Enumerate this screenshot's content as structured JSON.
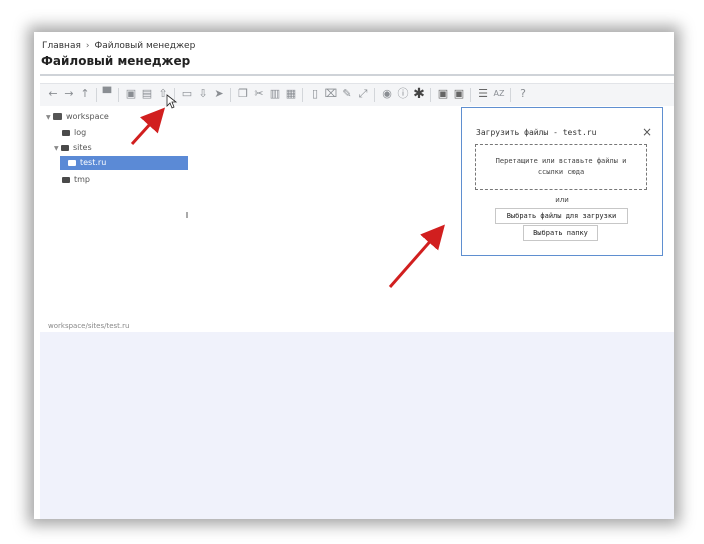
{
  "breadcrumb": {
    "home": "Главная",
    "separator": "›",
    "current": "Файловый менеджер"
  },
  "page_title": "Файловый менеджер",
  "tree": {
    "root": "workspace",
    "items": [
      {
        "label": "log"
      },
      {
        "label": "sites"
      },
      {
        "label": "test.ru"
      },
      {
        "label": "tmp"
      }
    ]
  },
  "status_path": "workspace/sites/test.ru",
  "upload_dialog": {
    "title": "Загрузить файлы - test.ru",
    "close": "×",
    "dropzone_text_line1": "Перетащите или вставьте файлы и",
    "dropzone_text_line2": "ссылки сюда",
    "or": "или",
    "select_files_button": "Выбрать файлы для загрузки",
    "select_folder_button": "Выбрать папку"
  },
  "colors": {
    "accent": "#5b8ad6",
    "dialog_border": "#5f8fd0",
    "annotation_arrow": "#d11f1f"
  },
  "toolbar_icons": [
    "back-icon",
    "forward-icon",
    "up-icon",
    "home-icon",
    "new-folder-icon",
    "new-file-icon",
    "upload-icon",
    "open-icon",
    "download-icon",
    "select-icon",
    "copy-icon",
    "cut-icon",
    "paste-icon",
    "delete-icon",
    "duplicate-icon",
    "rename-icon",
    "edit-icon",
    "resize-icon",
    "preview-icon",
    "info-icon",
    "favorite-icon",
    "archive-icon",
    "extract-icon",
    "view-icon",
    "sort-icon",
    "help-icon"
  ]
}
